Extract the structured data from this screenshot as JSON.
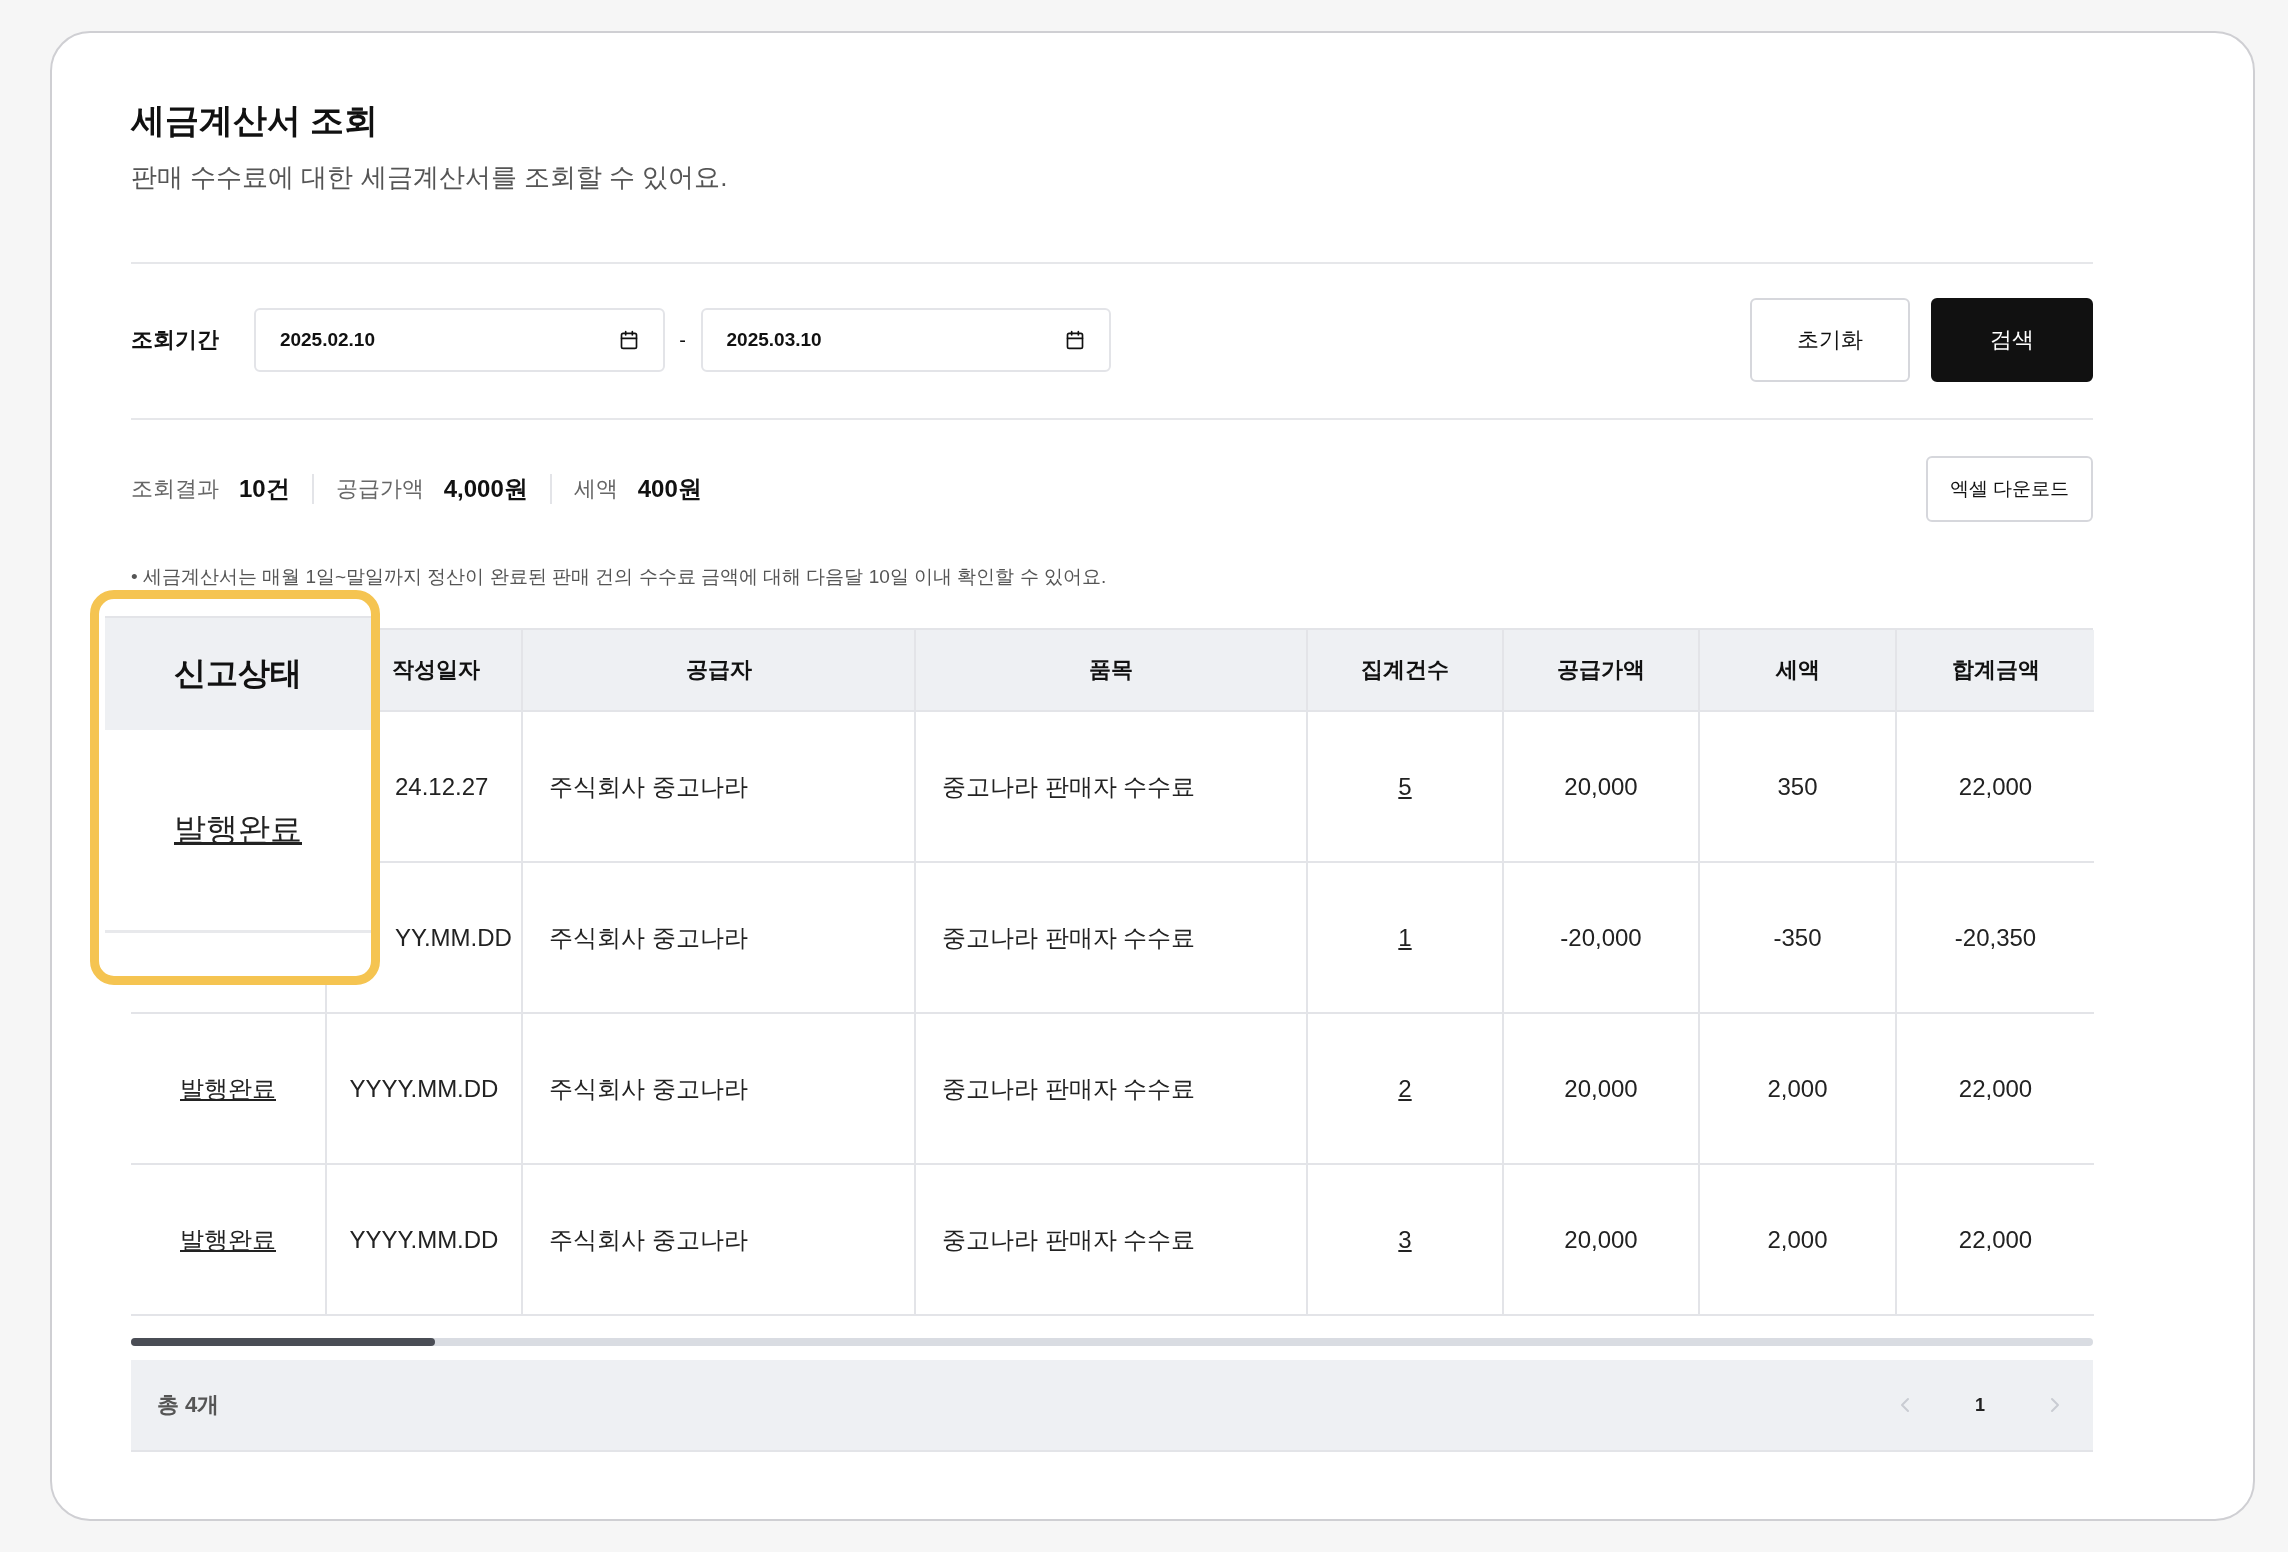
{
  "page": {
    "title": "세금계산서 조회",
    "description": "판매 수수료에 대한 세금계산서를 조회할 수 있어요."
  },
  "filter": {
    "label": "조회기간",
    "start_date": "2025.02.10",
    "separator": "-",
    "end_date": "2025.03.10",
    "reset_button": "초기화",
    "search_button": "검색"
  },
  "summary": {
    "items": [
      {
        "label": "조회결과",
        "value": "10건"
      },
      {
        "label": "공급가액",
        "value": "4,000원"
      },
      {
        "label": "세액",
        "value": "400원"
      }
    ],
    "download_button": "엑셀 다운로드"
  },
  "notice": "• 세금계산서는 매월 1일~말일까지 정산이 완료된 판매 건의 수수료 금액에 대해 다음달 10일 이내 확인할 수 있어요.",
  "table": {
    "columns": [
      "작성일자",
      "공급자",
      "품목",
      "집계건수",
      "공급가액",
      "세액",
      "합계금액"
    ],
    "rows": [
      {
        "cells": [
          "24.12.27",
          "주식회사 중고나라",
          "중고나라 판매자 수수료",
          "5",
          "20,000",
          "350",
          "22,000"
        ]
      },
      {
        "cells": [
          "YY.MM.DD",
          "주식회사 중고나라",
          "중고나라 판매자 수수료",
          "1",
          "-20,000",
          "-350",
          "-20,350"
        ]
      },
      {
        "status": "발행완료",
        "cells": [
          "YYYY.MM.DD",
          "주식회사 중고나라",
          "중고나라 판매자 수수료",
          "2",
          "20,000",
          "2,000",
          "22,000"
        ]
      },
      {
        "status": "발행완료",
        "cells": [
          "YYYY.MM.DD",
          "주식회사 중고나라",
          "중고나라 판매자 수수료",
          "3",
          "20,000",
          "2,000",
          "22,000"
        ]
      }
    ]
  },
  "callout": {
    "column": "신고상태",
    "value": "발행완료"
  },
  "footer": {
    "total": "총 4개",
    "page": "1"
  }
}
